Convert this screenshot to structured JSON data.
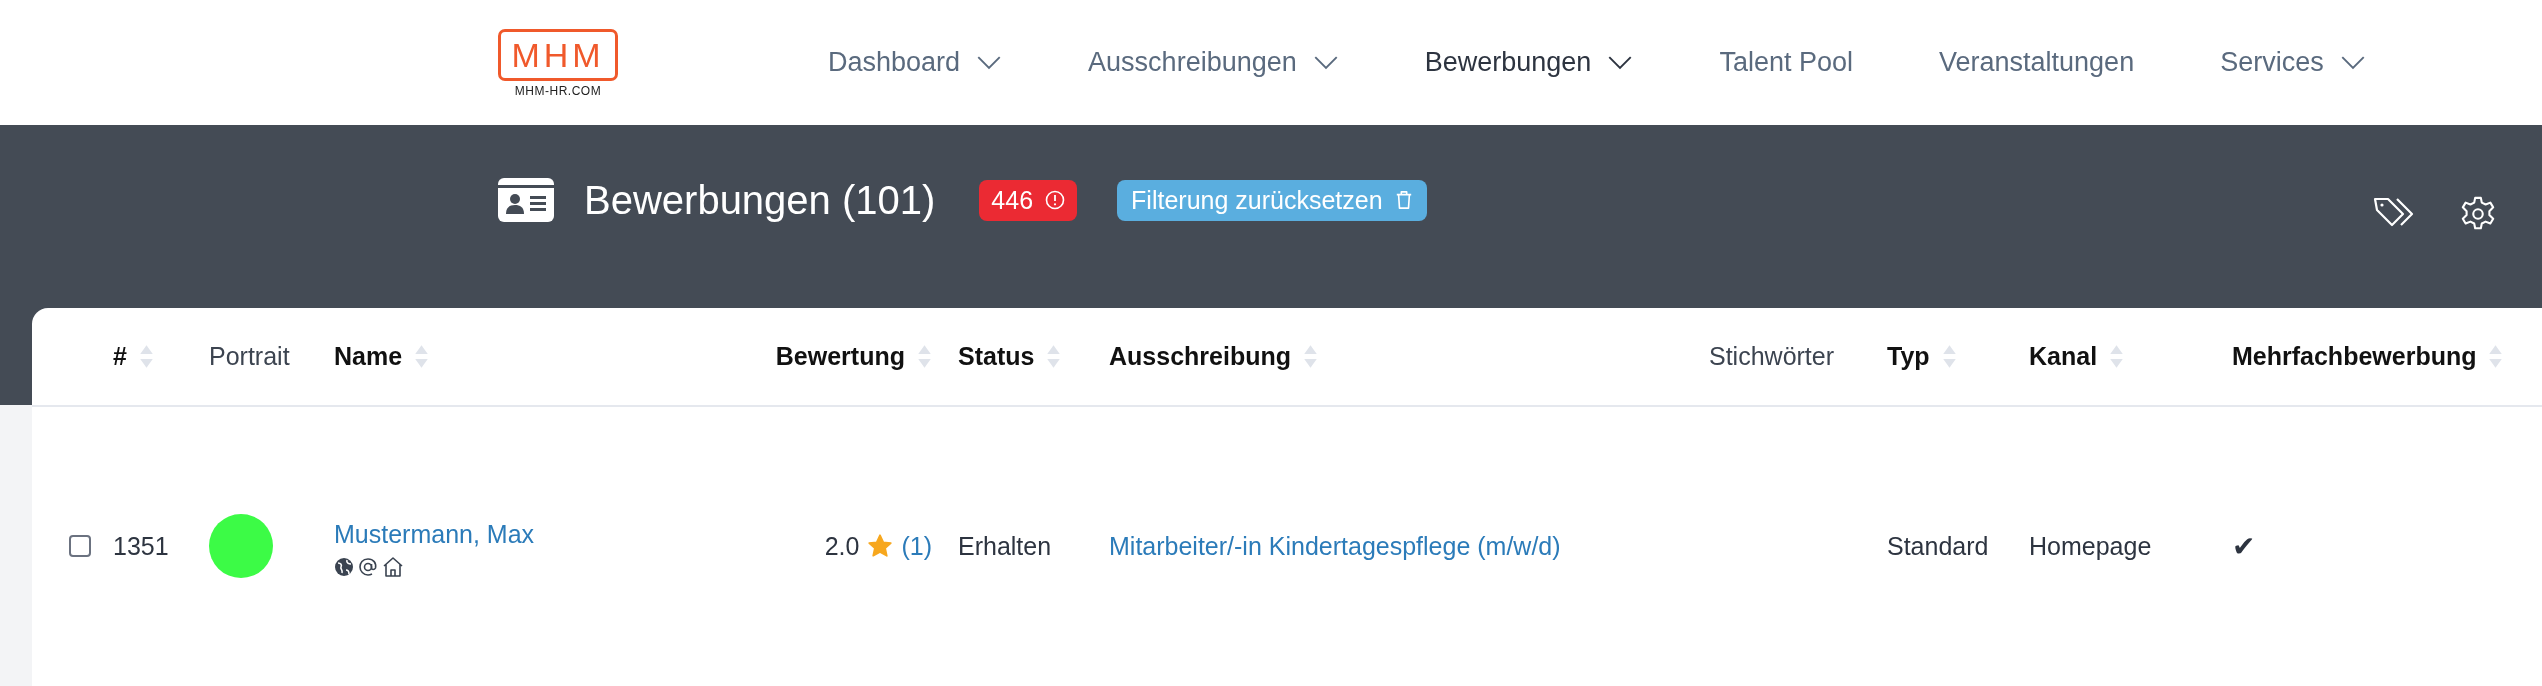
{
  "logo": {
    "mark": "MHM",
    "domain": "MHM-HR.COM"
  },
  "nav": [
    {
      "label": "Dashboard",
      "dropdown": true,
      "selected": false
    },
    {
      "label": "Ausschreibungen",
      "dropdown": true,
      "selected": false
    },
    {
      "label": "Bewerbungen",
      "dropdown": true,
      "selected": true
    },
    {
      "label": "Talent Pool",
      "dropdown": false,
      "selected": false
    },
    {
      "label": "Veranstaltungen",
      "dropdown": false,
      "selected": false
    },
    {
      "label": "Services",
      "dropdown": true,
      "selected": false
    }
  ],
  "header": {
    "title": "Bewerbungen (101)",
    "alert_badge": "446",
    "reset_button": "Filterung zurücksetzen"
  },
  "table": {
    "columns": [
      {
        "label": "#",
        "sortable": true
      },
      {
        "label": "Portrait",
        "sortable": false
      },
      {
        "label": "Name",
        "sortable": true
      },
      {
        "label": "Bewertung",
        "sortable": true
      },
      {
        "label": "Status",
        "sortable": true
      },
      {
        "label": "Ausschreibung",
        "sortable": true
      },
      {
        "label": "Stichwörter",
        "sortable": false
      },
      {
        "label": "Typ",
        "sortable": true
      },
      {
        "label": "Kanal",
        "sortable": true
      },
      {
        "label": "Mehrfachbewerbung",
        "sortable": true
      }
    ],
    "rows": [
      {
        "checked": false,
        "number": "1351",
        "name": "Mustermann, Max",
        "rating": "2.0",
        "rating_count": "(1)",
        "status": "Erhalten",
        "posting": "Mitarbeiter/-in Kindertagespflege (m/w/d)",
        "type": "Standard",
        "channel": "Homepage",
        "multiple": "✔"
      }
    ]
  }
}
